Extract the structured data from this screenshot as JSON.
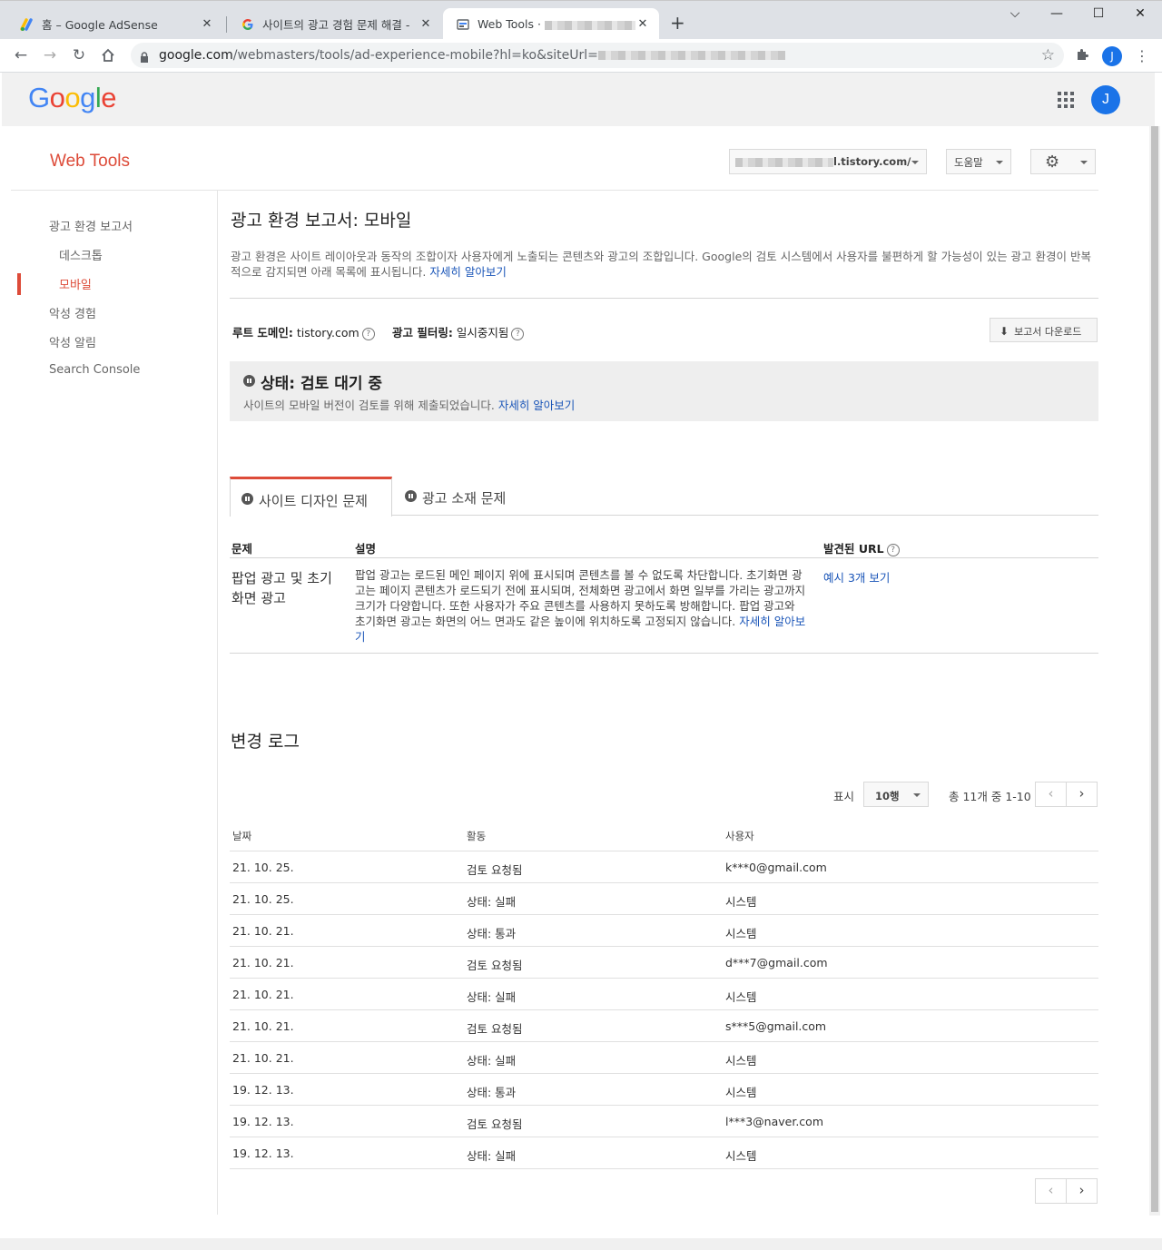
{
  "browser": {
    "tabs": [
      {
        "label": "홈 – Google AdSense",
        "icon": "adsense-icon"
      },
      {
        "label": "사이트의 광고 경험 문제 해결 -",
        "icon": "google-g-icon"
      },
      {
        "label": "Web Tools ·",
        "icon": "web-tools-icon",
        "active": true
      }
    ],
    "new_tab": "+",
    "window_controls": {
      "minimize": "—",
      "maximize": "☐",
      "close": "✕"
    },
    "url_host": "google.com",
    "url_path": "/webmasters/tools/ad-experience-mobile?hl=ko&siteUrl=",
    "profile_initial": "J"
  },
  "google": {
    "logo": [
      "G",
      "o",
      "o",
      "g",
      "l",
      "e"
    ],
    "avatar": "J"
  },
  "header": {
    "title": "Web Tools",
    "site": "l.tistory.com/",
    "help": "도움말"
  },
  "sidebar": {
    "items": [
      {
        "label": "광고 환경 보고서"
      },
      {
        "label": "데스크톱"
      },
      {
        "label": "모바일",
        "active": true
      },
      {
        "label": "악성 경험"
      },
      {
        "label": "악성 알림"
      },
      {
        "label": "Search Console"
      }
    ]
  },
  "main": {
    "title": "광고 환경 보고서: 모바일",
    "intro": "광고 환경은 사이트 레이아웃과 동작의 조합이자 사용자에게 노출되는 콘텐츠와 광고의 조합입니다. Google의 검토 시스템에서 사용자를 불편하게 할 가능성이 있는 광고 환경이 반복적으로 감지되면 아래 목록에 표시됩니다.",
    "learn_more": "자세히 알아보기",
    "root_domain_label": "루트 도메인:",
    "root_domain_value": "tistory.com",
    "ad_filter_label": "광고 필터링:",
    "ad_filter_value": "일시중지됨",
    "download_button": "보고서 다운로드",
    "status_title": "상태: 검토 대기 중",
    "status_desc": "사이트의 모바일 버전이 검토를 위해 제출되었습니다.",
    "tabs": [
      {
        "label": "사이트 디자인 문제",
        "active": true
      },
      {
        "label": "광고 소재 문제"
      }
    ],
    "issues_headers": {
      "issue": "문제",
      "description": "설명",
      "found_urls": "발견된 URL"
    },
    "issue": {
      "name": "팝업 광고 및 초기화면 광고",
      "description": "팝업 광고는 로드된 메인 페이지 위에 표시되며 콘텐츠를 볼 수 없도록 차단합니다. 초기화면 광고는 페이지 콘텐츠가 로드되기 전에 표시되며, 전체화면 광고에서 화면 일부를 가리는 광고까지 크기가 다양합니다. 또한 사용자가 주요 콘텐츠를 사용하지 못하도록 방해합니다. 팝업 광고와 초기화면 광고는 화면의 어느 면과도 같은 높이에 위치하도록 고정되지 않습니다.",
      "learn_more": "자세히 알아보기",
      "examples": "예시 3개 보기"
    }
  },
  "changelog": {
    "title": "변경 로그",
    "show_label": "표시",
    "rows_option": "10행",
    "range": "총 11개 중 1-10",
    "headers": {
      "date": "날짜",
      "activity": "활동",
      "user": "사용자"
    },
    "rows": [
      {
        "date": "21. 10. 25.",
        "activity": "검토 요청됨",
        "user": "k***0@gmail.com"
      },
      {
        "date": "21. 10. 25.",
        "activity": "상태: 실패",
        "user": "시스템"
      },
      {
        "date": "21. 10. 21.",
        "activity": "상태: 통과",
        "user": "시스템"
      },
      {
        "date": "21. 10. 21.",
        "activity": "검토 요청됨",
        "user": "d***7@gmail.com"
      },
      {
        "date": "21. 10. 21.",
        "activity": "상태: 실패",
        "user": "시스템"
      },
      {
        "date": "21. 10. 21.",
        "activity": "검토 요청됨",
        "user": "s***5@gmail.com"
      },
      {
        "date": "21. 10. 21.",
        "activity": "상태: 실패",
        "user": "시스템"
      },
      {
        "date": "19. 12. 13.",
        "activity": "상태: 통과",
        "user": "시스템"
      },
      {
        "date": "19. 12. 13.",
        "activity": "검토 요청됨",
        "user": "l***3@naver.com"
      },
      {
        "date": "19. 12. 13.",
        "activity": "상태: 실패",
        "user": "시스템"
      }
    ],
    "prev": "‹",
    "next": "›"
  },
  "colors": {
    "brand_red": "#dd4b39",
    "link_blue": "#1a55b8",
    "avatar_blue": "#1a73e8"
  }
}
